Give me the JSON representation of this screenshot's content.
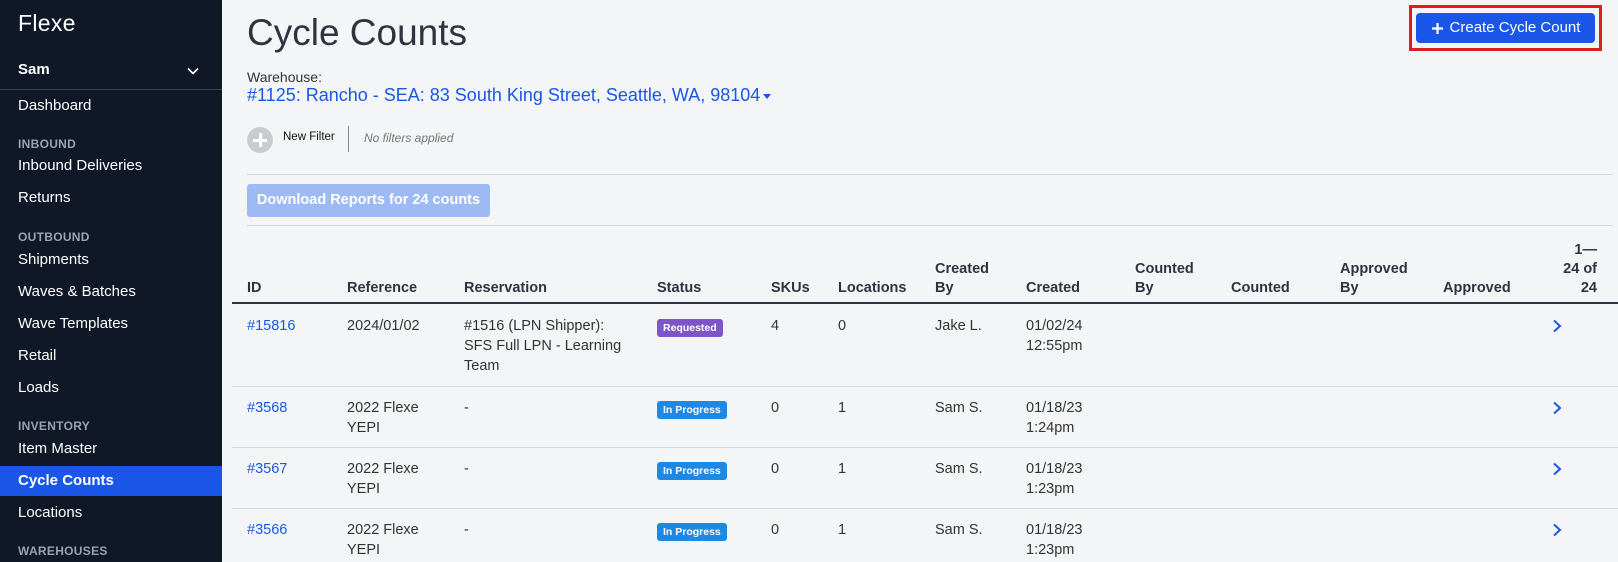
{
  "sidebar": {
    "logo": "Flexe",
    "user": "Sam",
    "items": [
      {
        "label": "Dashboard"
      },
      {
        "section": "INBOUND"
      },
      {
        "label": "Inbound Deliveries"
      },
      {
        "label": "Returns"
      },
      {
        "section": "OUTBOUND"
      },
      {
        "label": "Shipments"
      },
      {
        "label": "Waves & Batches"
      },
      {
        "label": "Wave Templates"
      },
      {
        "label": "Retail"
      },
      {
        "label": "Loads"
      },
      {
        "section": "INVENTORY"
      },
      {
        "label": "Item Master"
      },
      {
        "label": "Cycle Counts",
        "active": true
      },
      {
        "label": "Locations"
      },
      {
        "section": "WAREHOUSES"
      }
    ]
  },
  "header": {
    "title": "Cycle Counts",
    "create_button": "Create Cycle Count"
  },
  "warehouse": {
    "label": "Warehouse:",
    "value": "#1125: Rancho - SEA: 83 South King Street, Seattle, WA, 98104"
  },
  "filters": {
    "new_filter": "New Filter",
    "status": "No filters applied"
  },
  "download_button": "Download Reports for 24 counts",
  "table": {
    "headers": {
      "id": "ID",
      "reference": "Reference",
      "reservation": "Reservation",
      "status": "Status",
      "skus": "SKUs",
      "locations": "Locations",
      "created_by_1": "Created",
      "created_by_2": "By",
      "created": "Created",
      "counted_by_1": "Counted",
      "counted_by_2": "By",
      "counted": "Counted",
      "approved_by_1": "Approved",
      "approved_by_2": "By",
      "approved": "Approved",
      "pagination_1": "1—",
      "pagination_2": "24 of",
      "pagination_3": "24"
    },
    "rows": [
      {
        "id": "#15816",
        "reference": "2024/01/02",
        "reservation_1": "#1516 (LPN Shipper):",
        "reservation_2": "SFS Full LPN - Learning",
        "reservation_3": "Team",
        "status": "Requested",
        "skus": "4",
        "locations": "0",
        "created_by": "Jake L.",
        "created_date": "01/02/24",
        "created_time": "12:55pm"
      },
      {
        "id": "#3568",
        "reference_1": "2022 Flexe",
        "reference_2": "YEPI",
        "reservation_1": "-",
        "status": "In Progress",
        "skus": "0",
        "locations": "1",
        "created_by": "Sam S.",
        "created_date": "01/18/23",
        "created_time": "1:24pm"
      },
      {
        "id": "#3567",
        "reference_1": "2022 Flexe",
        "reference_2": "YEPI",
        "reservation_1": "-",
        "status": "In Progress",
        "skus": "0",
        "locations": "1",
        "created_by": "Sam S.",
        "created_date": "01/18/23",
        "created_time": "1:23pm"
      },
      {
        "id": "#3566",
        "reference_1": "2022 Flexe",
        "reference_2": "YEPI",
        "reservation_1": "-",
        "status": "In Progress",
        "skus": "0",
        "locations": "1",
        "created_by": "Sam S.",
        "created_date": "01/18/23",
        "created_time": "1:23pm"
      }
    ]
  },
  "colors": {
    "sidebar_bg": "#101828",
    "accent": "#1a56e8",
    "requested": "#7d55c7",
    "in_progress": "#1e88e5",
    "highlight": "#e01e1e"
  }
}
